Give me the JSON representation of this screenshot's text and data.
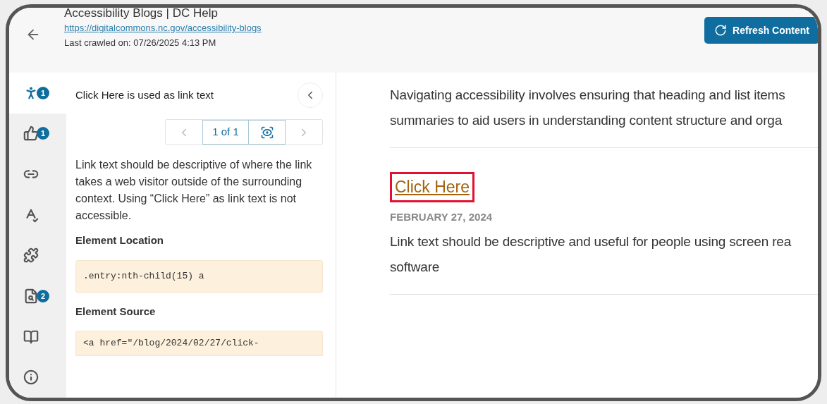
{
  "header": {
    "title": "Accessibility Blogs | DC Help",
    "url": "https://digitalcommons.nc.gov/accessibility-blogs",
    "crawled": "Last crawled on: 07/26/2025 4:13 PM",
    "refresh_button": "Refresh Content"
  },
  "sidebar": {
    "items": [
      {
        "kind": "accessibility",
        "badge": "1",
        "selected": true
      },
      {
        "kind": "thumbs",
        "badge": "1",
        "selected": false
      },
      {
        "kind": "link",
        "selected": false
      },
      {
        "kind": "spelling",
        "selected": false
      },
      {
        "kind": "puzzle",
        "selected": false
      },
      {
        "kind": "search",
        "badge": "2",
        "selected": false
      },
      {
        "kind": "reader",
        "selected": false
      },
      {
        "kind": "info",
        "selected": false
      }
    ]
  },
  "issue": {
    "title": "Click Here is used as link text",
    "pager": "1 of 1",
    "description": "Link text should be descriptive of where the link takes a web visitor outside of the surrounding context. Using “Click Here” as link text is not accessible.",
    "location_label": "Element Location",
    "location": ".entry:nth-child(15) a",
    "source_label": "Element Source",
    "source": "<a href=\"/blog/2024/02/27/click-"
  },
  "content": {
    "intro": [
      "Navigating accessibility involves ensuring that heading and list items",
      "summaries to aid users in understanding content structure and orga"
    ],
    "post": {
      "title": "Click Here",
      "highlighted": true,
      "date": "FEBRUARY 27, 2024",
      "summary": [
        "Link text should be descriptive and useful for people using screen rea",
        "software"
      ]
    }
  }
}
